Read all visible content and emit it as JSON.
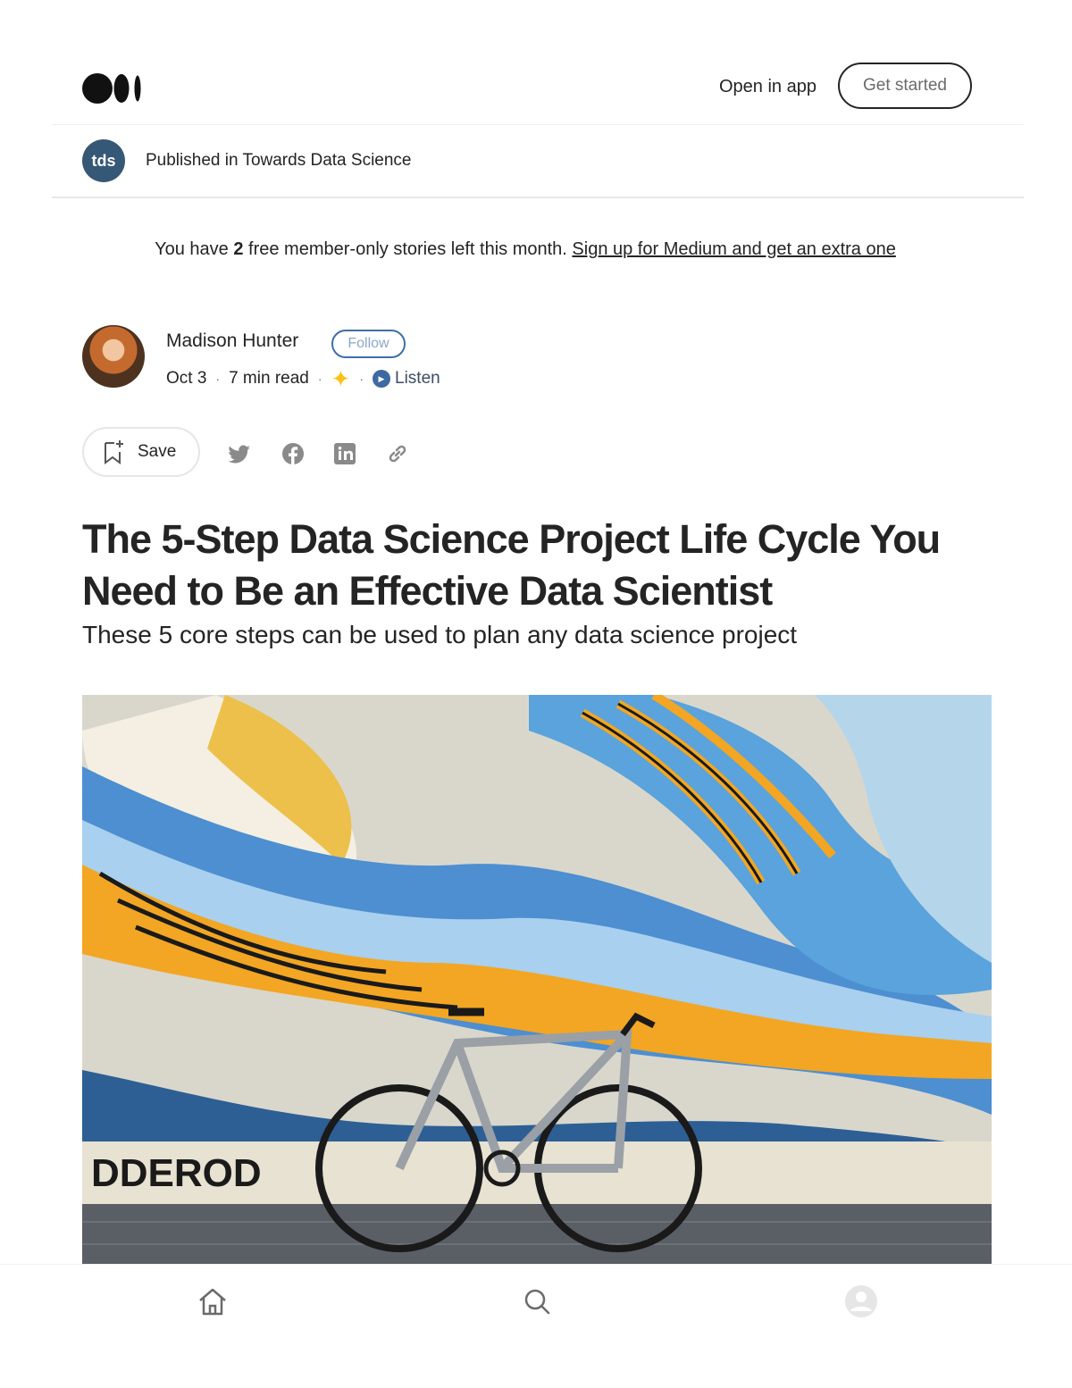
{
  "header": {
    "open_in_app": "Open in app",
    "get_started": "Get started"
  },
  "publication": {
    "avatar_text": "tds",
    "published_in": "Published in Towards Data Science"
  },
  "banner": {
    "prefix": "You have ",
    "count": "2",
    "suffix": " free member-only stories left this month. ",
    "link": "Sign up for Medium and get an extra one"
  },
  "author": {
    "name": "Madison Hunter",
    "follow": "Follow",
    "date": "Oct 3",
    "read_time": "7 min read",
    "sep": "·",
    "listen": "Listen"
  },
  "actions": {
    "save": "Save",
    "share_icons": [
      "twitter-icon",
      "facebook-icon",
      "linkedin-icon",
      "link-icon"
    ]
  },
  "article": {
    "title": "The 5-Step Data Science Project Life Cycle You Need to Be an Effective Data Scientist",
    "subtitle": "These 5 core steps can be used to plan any data science project"
  },
  "bottom_nav": {
    "icons": [
      "home-icon",
      "search-icon",
      "profile-icon"
    ]
  },
  "colors": {
    "text": "#242424",
    "muted": "#6b6b6b",
    "publication": "#355876",
    "follow": "#3f6ea6",
    "star": "#ffc017"
  }
}
